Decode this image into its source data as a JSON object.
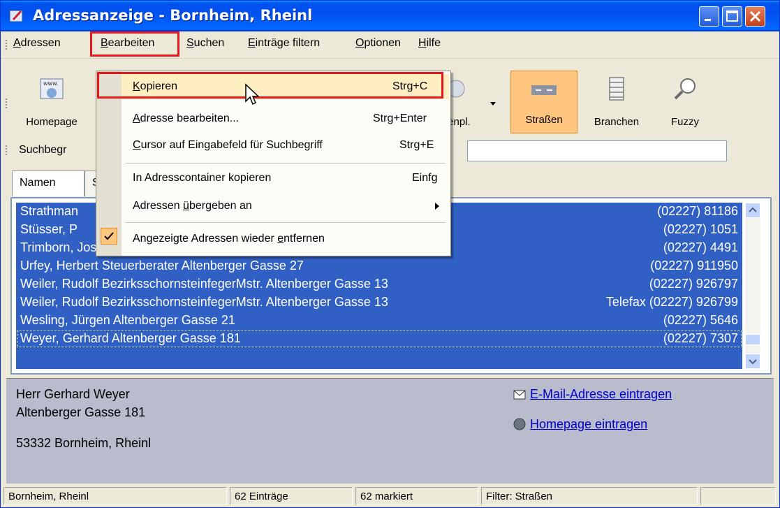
{
  "window": {
    "title": "Adressanzeige - Bornheim, Rheinl"
  },
  "menu": {
    "items": [
      {
        "label": "Adressen",
        "accel": "A",
        "rest": "dressen"
      },
      {
        "label": "Bearbeiten",
        "accel": "B",
        "rest": "earbeiten"
      },
      {
        "label": "Suchen",
        "accel": "S",
        "rest": "uchen"
      },
      {
        "label": "Einträge filtern",
        "accel": "E",
        "rest": "inträge filtern"
      },
      {
        "label": "Optionen",
        "accel": "O",
        "rest": "ptionen"
      },
      {
        "label": "Hilfe",
        "accel": "H",
        "rest": "ilfe"
      }
    ]
  },
  "toolbar": {
    "homepage_label": "Homepage",
    "partial_label": "tenpl.",
    "strassen_label": "Straßen",
    "branchen_label": "Branchen",
    "fuzzy_label": "Fuzzy"
  },
  "search": {
    "label": "Suchbegr"
  },
  "tabs": [
    {
      "label": "Namen"
    },
    {
      "label": "S"
    }
  ],
  "list": {
    "rows": [
      {
        "name": "Strathman",
        "phone": "(02227) 81186"
      },
      {
        "name": "Stüsser, P",
        "phone": "(02227) 1051"
      },
      {
        "name": "Trimborn, Josef Altenberger Gasse 174",
        "phone": "(02227) 4491"
      },
      {
        "name": "Urfey, Herbert Steuerberater Altenberger Gasse 27",
        "phone": "(02227) 911950"
      },
      {
        "name": "Weiler, Rudolf BezirksschornsteinfegerMstr. Altenberger Gasse 13",
        "phone": "(02227) 926797"
      },
      {
        "name": "Weiler, Rudolf BezirksschornsteinfegerMstr. Altenberger Gasse 13",
        "phone": "Telefax (02227) 926799"
      },
      {
        "name": "Wesling, Jürgen Altenberger Gasse 21",
        "phone": "(02227) 5646"
      },
      {
        "name": "Weyer, Gerhard Altenberger Gasse 181",
        "phone": "(02227) 7307"
      }
    ]
  },
  "details": {
    "line1": "Herr Gerhard Weyer",
    "line2": "Altenberger Gasse 181",
    "line3": "53332 Bornheim, Rheinl",
    "email_link": "E-Mail-Adresse eintragen",
    "homepage_link": "Homepage eintragen"
  },
  "status": {
    "city": "Bornheim, Rheinl",
    "entries": "62 Einträge",
    "marked": "62 markiert",
    "filter": "Filter: Straßen"
  },
  "dropdown": {
    "items": [
      {
        "accel": "K",
        "rest": "opieren",
        "shortcut": "Strg+C"
      },
      {
        "accel": "A",
        "rest": "dresse bearbeiten...",
        "shortcut": "Strg+Enter"
      },
      {
        "accel": "C",
        "rest": "ursor auf Eingabefeld für Suchbegriff",
        "shortcut": "Strg+E"
      },
      {
        "label": "In Adresscontainer kopieren",
        "shortcut": "Einfg"
      },
      {
        "pre": "Adressen ",
        "accel": "ü",
        "rest": "bergeben an"
      },
      {
        "pre": "Angezeigte Adressen wieder ",
        "accel": "e",
        "rest": "ntfernen"
      }
    ]
  },
  "colors": {
    "selection": "#3160c4",
    "highlight": "#e8171b",
    "titlebar": "#0053ee"
  }
}
